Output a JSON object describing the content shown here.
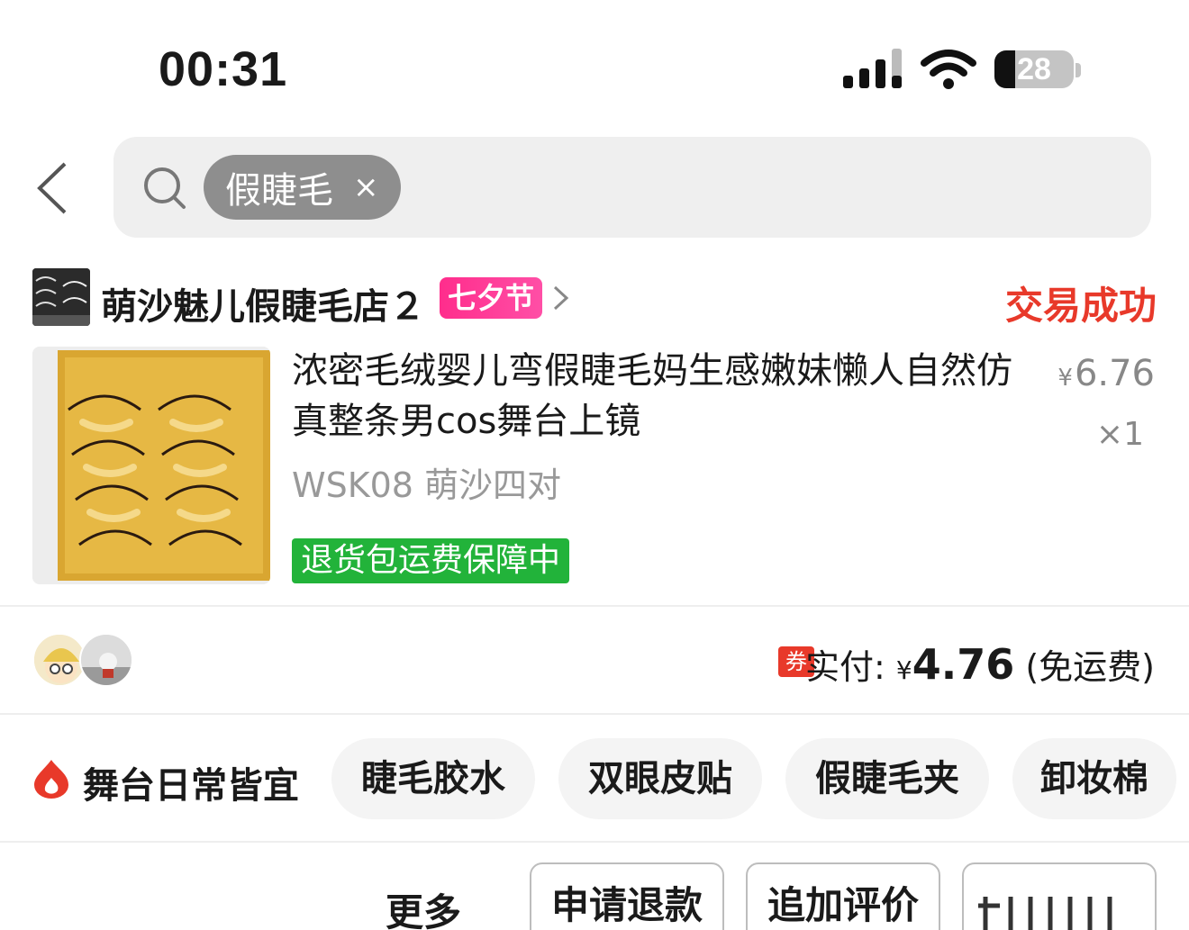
{
  "status_bar": {
    "time": "00:31",
    "battery": "28",
    "icons": [
      "signal-icon",
      "wifi-icon",
      "battery-icon"
    ]
  },
  "search": {
    "back_icon": "chevron-left-icon",
    "search_icon": "search-icon",
    "query_chip": "假睫毛",
    "chip_clear": "×"
  },
  "order": {
    "shop_name": "萌沙魅儿假睫毛店２",
    "festival_badge": "七夕节",
    "status": "交易成功",
    "product": {
      "title": "浓密毛绒婴儿弯假睫毛妈生感嫩妹懒人自然仿真整条男cos舞台上镜",
      "sku": "WSK08 萌沙四对",
      "return_badge": "退货包运费保障中",
      "currency": "¥",
      "price": "6.76",
      "quantity": "×1"
    },
    "payment": {
      "coupon": "券",
      "label": "实付:",
      "currency": "¥",
      "amount": "4.76",
      "shipping_note": "(免运费)"
    }
  },
  "recommend": {
    "label": "舞台日常皆宜",
    "tags": [
      "睫毛胶水",
      "双眼皮贴",
      "假睫毛夹",
      "卸妆棉"
    ]
  },
  "actions": {
    "more": "更多",
    "buttons": [
      "申请退款",
      "追加评价",
      ""
    ]
  },
  "colors": {
    "status_success": "#e8392a",
    "festival_badge": "#ff2d8c",
    "return_badge": "#22b33a"
  }
}
